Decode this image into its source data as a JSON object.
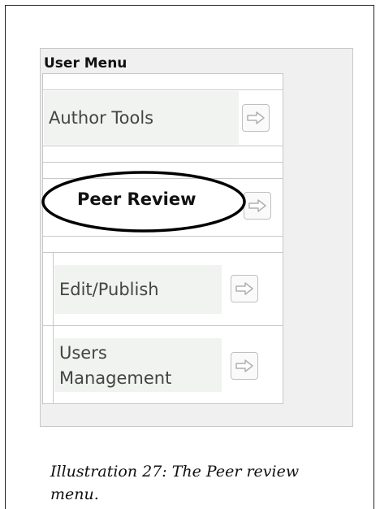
{
  "menu": {
    "title": "User Menu",
    "items": [
      {
        "label": "Author Tools",
        "icon": "arrow-right-icon"
      },
      {
        "label": "Peer Review",
        "icon": "arrow-right-icon",
        "highlighted": true
      },
      {
        "label": "Edit/Publish",
        "icon": "arrow-right-icon"
      },
      {
        "label": "Users Management",
        "icon": "arrow-right-icon"
      }
    ]
  },
  "caption": "Illustration 27: The Peer review menu.",
  "colors": {
    "panel_bg": "#f0f0f0",
    "item_bg": "#f1f3f0",
    "border": "#c8c8c8",
    "text": "#444444"
  }
}
